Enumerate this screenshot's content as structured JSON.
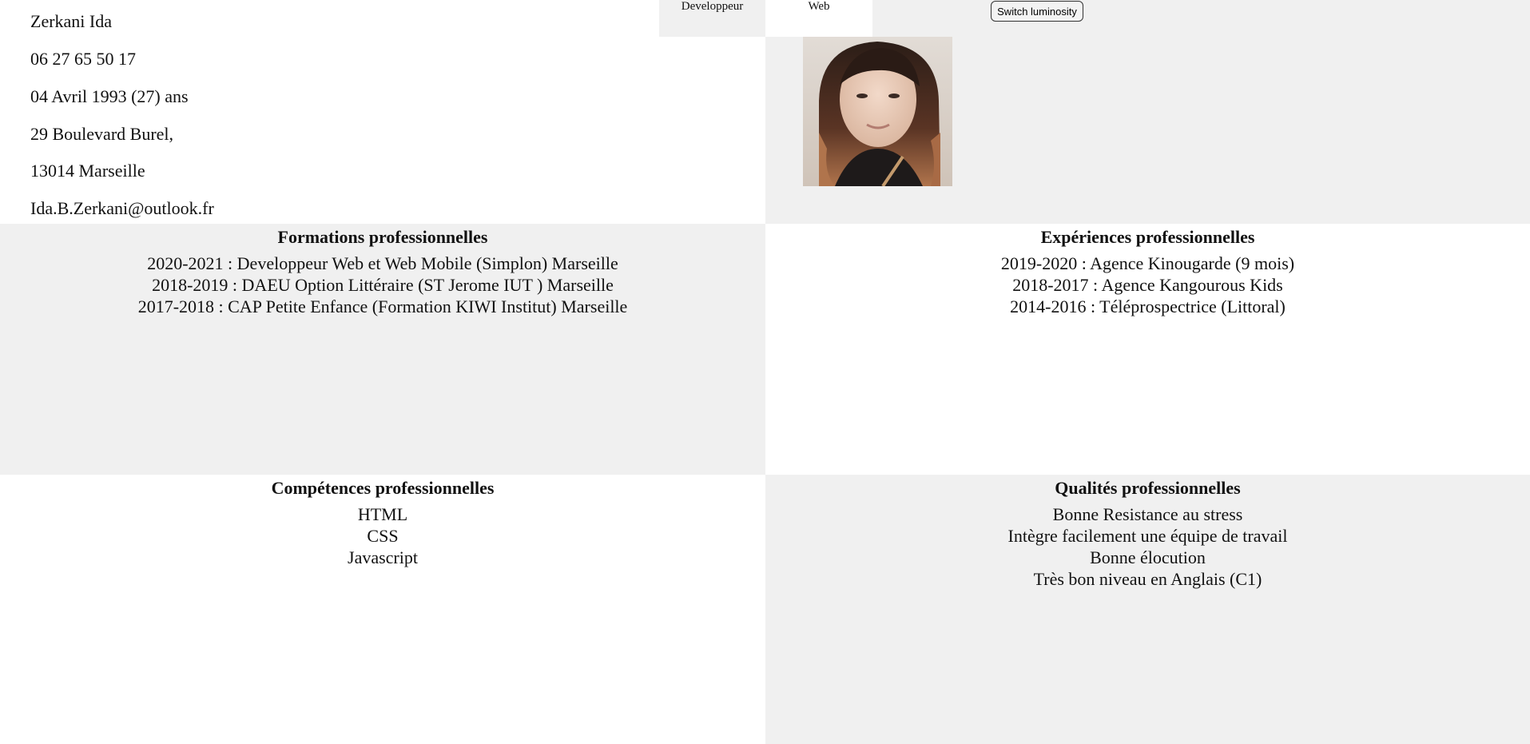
{
  "contact": {
    "name": "Zerkani Ida",
    "phone": "06 27 65 50 17",
    "birth": "04 Avril 1993 (27) ans",
    "address_line1": "29 Boulevard Burel,",
    "address_line2": "13014 Marseille",
    "email": "Ida.B.Zerkani@outlook.fr"
  },
  "header": {
    "tab_developpeur": "Developpeur",
    "tab_web": "Web",
    "switch_label": "Switch luminosity"
  },
  "photo": {
    "icon": "profile-photo"
  },
  "formations": {
    "title": "Formations professionnelles",
    "items": [
      "2020-2021 : Developpeur Web et Web Mobile (Simplon) Marseille",
      "2018-2019 : DAEU Option Littéraire (ST Jerome IUT ) Marseille",
      "2017-2018 : CAP Petite Enfance (Formation KIWI Institut) Marseille"
    ]
  },
  "experiences": {
    "title": "Expériences professionnelles",
    "items": [
      "2019-2020 : Agence Kinougarde (9 mois)",
      "2018-2017 : Agence Kangourous Kids",
      "2014-2016 : Téléprospectrice (Littoral)"
    ]
  },
  "competences": {
    "title": "Compétences professionnelles",
    "items": [
      "HTML",
      "CSS",
      "Javascript"
    ]
  },
  "qualites": {
    "title": "Qualités professionnelles",
    "items": [
      "Bonne Resistance au stress",
      "Intègre facilement une équipe de travail",
      "Bonne élocution",
      "Très bon niveau en Anglais (C1)"
    ]
  },
  "colors": {
    "panel_gray": "#f0f0f0",
    "panel_white": "#ffffff",
    "text": "#111111"
  }
}
